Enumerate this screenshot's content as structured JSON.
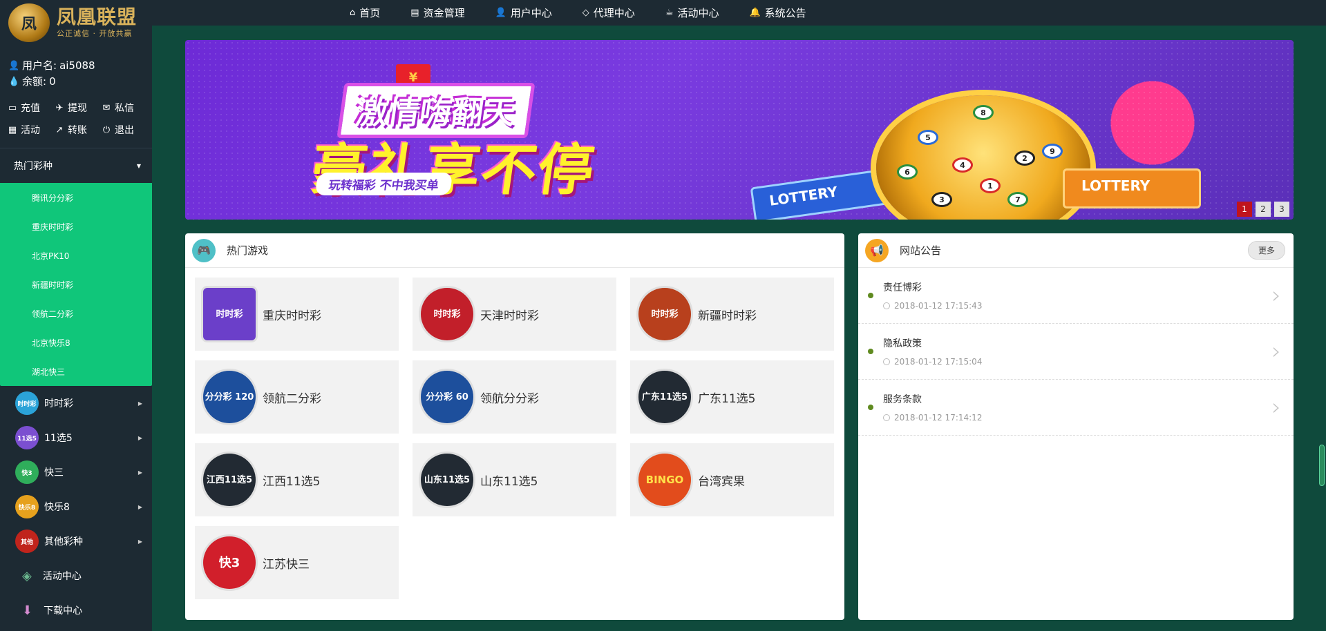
{
  "logo": {
    "mark": "凤",
    "title": "凤凰联盟",
    "subtitle": "公正诚信 · 开放共赢"
  },
  "user": {
    "username_label": "用户名:",
    "username": "ai5088",
    "balance_label": "余额:",
    "balance": "0"
  },
  "quick_actions": [
    {
      "label": "充值",
      "icon": "▭"
    },
    {
      "label": "提现",
      "icon": "✈"
    },
    {
      "label": "私信",
      "icon": "✉"
    },
    {
      "label": "活动",
      "icon": "▦"
    },
    {
      "label": "转账",
      "icon": "↗"
    },
    {
      "label": "退出",
      "icon": "⏻"
    }
  ],
  "hot_lottery": {
    "heading": "热门彩种",
    "items": [
      "腾讯分分彩",
      "重庆时时彩",
      "北京PK10",
      "新疆时时彩",
      "领航二分彩",
      "北京快乐8",
      "湖北快三"
    ]
  },
  "menu": [
    {
      "label": "时时彩",
      "badge": "时时彩",
      "color": "#2ba3d8"
    },
    {
      "label": "11选5",
      "badge": "11选5",
      "color": "#7b4fd0"
    },
    {
      "label": "快三",
      "badge": "快3",
      "color": "#2fae5b"
    },
    {
      "label": "快乐8",
      "badge": "快乐8",
      "color": "#e6a11d"
    },
    {
      "label": "其他彩种",
      "badge": "其他",
      "color": "#c0241c"
    }
  ],
  "menu_plain": [
    {
      "label": "活动中心",
      "icon": "◈"
    },
    {
      "label": "下载中心",
      "icon": "⬇"
    }
  ],
  "topnav": [
    {
      "label": "首页",
      "icon": "⌂"
    },
    {
      "label": "资金管理",
      "icon": "▤"
    },
    {
      "label": "用户中心",
      "icon": "👤"
    },
    {
      "label": "代理中心",
      "icon": "◇"
    },
    {
      "label": "活动中心",
      "icon": "☕"
    },
    {
      "label": "系统公告",
      "icon": "🔔"
    }
  ],
  "banner": {
    "line1": "激情嗨翻天",
    "line2": "豪礼享不停",
    "sub": "玩转福彩 不中我买单",
    "ticket": "LOTTERY",
    "envelope": "¥",
    "pages": [
      "1",
      "2",
      "3"
    ]
  },
  "hot_games": {
    "heading": "热门游戏",
    "items": [
      {
        "name": "重庆时时彩",
        "icon_text": "时时彩",
        "color": "#6b3fc9"
      },
      {
        "name": "天津时时彩",
        "icon_text": "时时彩",
        "color": "#c21f2a"
      },
      {
        "name": "新疆时时彩",
        "icon_text": "时时彩",
        "color": "#b8401d"
      },
      {
        "name": "领航二分彩",
        "icon_text": "分分彩 120",
        "color": "#1d4f9c"
      },
      {
        "name": "领航分分彩",
        "icon_text": "分分彩 60",
        "color": "#1d4f9c"
      },
      {
        "name": "广东11选5",
        "icon_text": "广东11选5",
        "color": "#222a33"
      },
      {
        "name": "江西11选5",
        "icon_text": "江西11选5",
        "color": "#222a33"
      },
      {
        "name": "山东11选5",
        "icon_text": "山东11选5",
        "color": "#222a33"
      },
      {
        "name": "台湾宾果",
        "icon_text": "BINGO",
        "color": "#e24c1c"
      },
      {
        "name": "江苏快三",
        "icon_text": "快3",
        "color": "#d11f2b"
      }
    ]
  },
  "notices": {
    "heading": "网站公告",
    "more": "更多",
    "items": [
      {
        "title": "责任博彩",
        "time": "2018-01-12 17:15:43"
      },
      {
        "title": "隐私政策",
        "time": "2018-01-12 17:15:04"
      },
      {
        "title": "服务条款",
        "time": "2018-01-12 17:14:12"
      }
    ]
  },
  "colors": {
    "sidebar": "#1d2a33",
    "accent_green": "#10c67a",
    "page_bg": "#0f4a3c",
    "active_page": "#c0141c"
  }
}
